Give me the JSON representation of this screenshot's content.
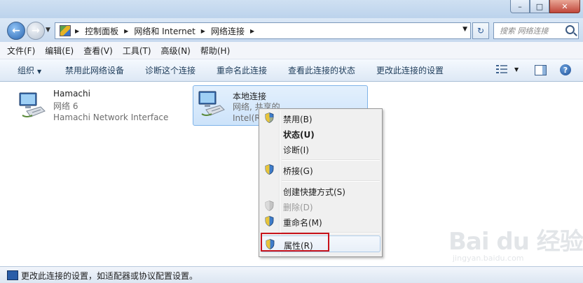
{
  "address": {
    "crumbs": [
      "控制面板",
      "网络和 Internet",
      "网络连接"
    ],
    "search_placeholder": "搜索 网络连接"
  },
  "menu": [
    "文件(F)",
    "编辑(E)",
    "查看(V)",
    "工具(T)",
    "高级(N)",
    "帮助(H)"
  ],
  "commands": {
    "organize": "组织",
    "items": [
      "禁用此网络设备",
      "诊断这个连接",
      "重命名此连接",
      "查看此连接的状态",
      "更改此连接的设置"
    ]
  },
  "connections": [
    {
      "name": "Hamachi",
      "status": "网络  6",
      "device": "Hamachi Network Interface",
      "selected": false
    },
    {
      "name": "本地连接",
      "status": "网络, 共享的",
      "device": "Intel(R",
      "selected": true
    }
  ],
  "context_menu": [
    {
      "label": "禁用(B)",
      "shield": true
    },
    {
      "label": "状态(U)",
      "bold": true
    },
    {
      "label": "诊断(I)"
    },
    {
      "label": "桥接(G)",
      "shield": true
    },
    {
      "label": "创建快捷方式(S)"
    },
    {
      "label": "删除(D)",
      "shield": true,
      "disabled": true
    },
    {
      "label": "重命名(M)",
      "shield": true
    },
    {
      "label": "属性(R)",
      "shield": true,
      "hover": true,
      "highlighted": true
    }
  ],
  "statusbar": {
    "text": "更改此连接的设置，如适配器或协议配置设置。"
  },
  "watermark": {
    "brand": "Bai du 经验",
    "url": "jingyan.baidu.com"
  },
  "colors": {
    "highlight_border": "#c8131b",
    "selection": "#cde3fa"
  }
}
